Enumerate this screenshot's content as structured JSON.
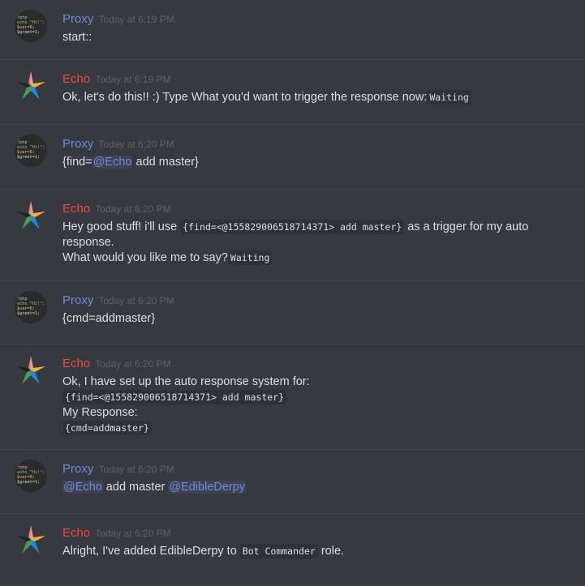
{
  "colors": {
    "proxy": "#7289da",
    "echo": "#e74c3c",
    "mention": "#7289da",
    "background": "#36393f",
    "code_bg": "#2f3136"
  },
  "avatars": {
    "proxy": {
      "icon": "php-code-avatar-icon",
      "lines": [
        "?php",
        "echo \"Hi!\";",
        "$var=0;",
        "$greet=1;"
      ]
    },
    "echo": {
      "icon": "colorful-star-avatar-icon"
    }
  },
  "messages": [
    {
      "author": "Proxy",
      "time": "Today at 6:19 PM",
      "parts": [
        {
          "t": "start::"
        }
      ]
    },
    {
      "author": "Echo",
      "time": "Today at 6:19 PM",
      "parts": [
        {
          "t": "Ok, let's do this!! :) Type What you'd want to trigger the response now:"
        },
        {
          "c": "Waiting"
        }
      ]
    },
    {
      "author": "Proxy",
      "time": "Today at 6:20 PM",
      "parts": [
        {
          "t": "{find="
        },
        {
          "m": "@Echo"
        },
        {
          "t": " add master}"
        }
      ]
    },
    {
      "author": "Echo",
      "time": "Today at 6:20 PM",
      "parts": [
        {
          "t": "Hey good stuff! i'll use "
        },
        {
          "c": "{find=<@155829006518714371> add master}"
        },
        {
          "t": " as a trigger for my auto response."
        },
        {
          "br": true
        },
        {
          "t": "What would you like me to say?"
        },
        {
          "c": "Waiting"
        }
      ]
    },
    {
      "author": "Proxy",
      "time": "Today at 6:20 PM",
      "parts": [
        {
          "t": "{cmd=addmaster}"
        }
      ]
    },
    {
      "author": "Echo",
      "time": "Today at 6:20 PM",
      "parts": [
        {
          "t": "Ok, I have set up the auto response system for:"
        },
        {
          "br": true
        },
        {
          "c": "{find=<@155829006518714371> add master}"
        },
        {
          "br": true
        },
        {
          "t": "My Response:"
        },
        {
          "br": true
        },
        {
          "c": "{cmd=addmaster}"
        }
      ]
    },
    {
      "author": "Proxy",
      "time": "Today at 6:20 PM",
      "parts": [
        {
          "m": "@Echo"
        },
        {
          "t": " add master "
        },
        {
          "m": "@EdibleDerpy"
        }
      ]
    },
    {
      "author": "Echo",
      "time": "Today at 6:20 PM",
      "parts": [
        {
          "t": "Alright, I've added EdibleDerpy to "
        },
        {
          "c": "Bot Commander"
        },
        {
          "t": " role."
        }
      ]
    }
  ]
}
